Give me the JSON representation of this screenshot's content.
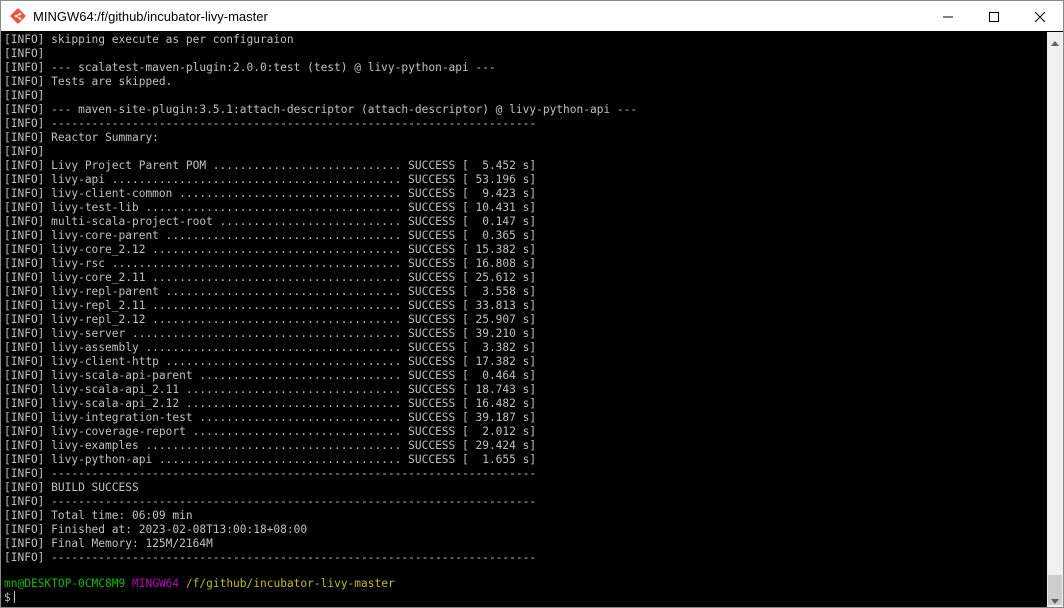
{
  "window": {
    "title": "MINGW64:/f/github/incubator-livy-master",
    "icon": "git-bash-icon",
    "controls": [
      "minimize-icon",
      "maximize-icon",
      "close-icon"
    ]
  },
  "terminal": {
    "lines": [
      "[INFO] skipping execute as per configuraion",
      "[INFO]",
      "[INFO] --- scalatest-maven-plugin:2.0.0:test (test) @ livy-python-api ---",
      "[INFO] Tests are skipped.",
      "[INFO]",
      "[INFO] --- maven-site-plugin:3.5.1:attach-descriptor (attach-descriptor) @ livy-python-api ---",
      "[INFO] ------------------------------------------------------------------------",
      "[INFO] Reactor Summary:",
      "[INFO]",
      "[INFO] Livy Project Parent POM ............................ SUCCESS [  5.452 s]",
      "[INFO] livy-api ........................................... SUCCESS [ 53.196 s]",
      "[INFO] livy-client-common ................................. SUCCESS [  9.423 s]",
      "[INFO] livy-test-lib ...................................... SUCCESS [ 10.431 s]",
      "[INFO] multi-scala-project-root ........................... SUCCESS [  0.147 s]",
      "[INFO] livy-core-parent ................................... SUCCESS [  0.365 s]",
      "[INFO] livy-core_2.12 ..................................... SUCCESS [ 15.382 s]",
      "[INFO] livy-rsc ........................................... SUCCESS [ 16.808 s]",
      "[INFO] livy-core_2.11 ..................................... SUCCESS [ 25.612 s]",
      "[INFO] livy-repl-parent ................................... SUCCESS [  3.558 s]",
      "[INFO] livy-repl_2.11 ..................................... SUCCESS [ 33.813 s]",
      "[INFO] livy-repl_2.12 ..................................... SUCCESS [ 25.907 s]",
      "[INFO] livy-server ........................................ SUCCESS [ 39.210 s]",
      "[INFO] livy-assembly ...................................... SUCCESS [  3.382 s]",
      "[INFO] livy-client-http ................................... SUCCESS [ 17.382 s]",
      "[INFO] livy-scala-api-parent .............................. SUCCESS [  0.464 s]",
      "[INFO] livy-scala-api_2.11 ................................ SUCCESS [ 18.743 s]",
      "[INFO] livy-scala-api_2.12 ................................ SUCCESS [ 16.482 s]",
      "[INFO] livy-integration-test .............................. SUCCESS [ 39.187 s]",
      "[INFO] livy-coverage-report ............................... SUCCESS [  2.012 s]",
      "[INFO] livy-examples ...................................... SUCCESS [ 29.424 s]",
      "[INFO] livy-python-api .................................... SUCCESS [  1.655 s]",
      "[INFO] ------------------------------------------------------------------------",
      "[INFO] BUILD SUCCESS",
      "[INFO] ------------------------------------------------------------------------",
      "[INFO] Total time: 06:09 min",
      "[INFO] Finished at: 2023-02-08T13:00:18+08:00",
      "[INFO] Final Memory: 125M/2164M",
      "[INFO] ------------------------------------------------------------------------"
    ],
    "prompt": {
      "user_host": "mn@DESKTOP-0CMC8M9",
      "system": "MINGW64",
      "path": "/f/github/incubator-livy-master",
      "symbol": "$"
    }
  },
  "colors": {
    "background": "#000000",
    "text": "#c0c0c0",
    "prompt_user": "#00bf00",
    "prompt_system": "#bf00bf",
    "prompt_path": "#bfbf00"
  }
}
